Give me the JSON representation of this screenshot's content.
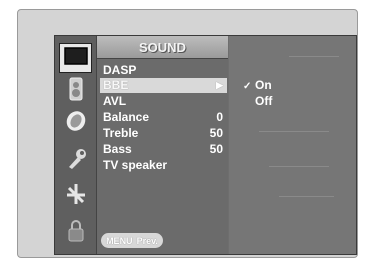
{
  "menu": {
    "title": "SOUND",
    "items": [
      {
        "label": "DASP",
        "value": ""
      },
      {
        "label": "BBE",
        "value": "",
        "submenu_arrow": "▶"
      },
      {
        "label": "AVL",
        "value": ""
      },
      {
        "label": "Balance",
        "value": "0"
      },
      {
        "label": "Treble",
        "value": "50"
      },
      {
        "label": "Bass",
        "value": "50"
      },
      {
        "label": "TV speaker",
        "value": ""
      }
    ],
    "selected_index": 1
  },
  "submenu": {
    "options": [
      {
        "label": "On",
        "checked": true,
        "check_mark": "✓"
      },
      {
        "label": "Off",
        "checked": false,
        "check_mark": ""
      }
    ]
  },
  "footer": {
    "key_label": "MENU",
    "action_label": "Prev."
  },
  "icons": [
    {
      "name": "screen-icon",
      "active": true
    },
    {
      "name": "speaker-icon",
      "active": false
    },
    {
      "name": "clock-icon",
      "active": false
    },
    {
      "name": "wrench-icon",
      "active": false
    },
    {
      "name": "satellite-icon",
      "active": false
    },
    {
      "name": "lock-icon",
      "active": false
    }
  ],
  "colors": {
    "panel": "#6e6e6e",
    "selected_row": "#d9d9d9",
    "text": "#ffffff"
  }
}
